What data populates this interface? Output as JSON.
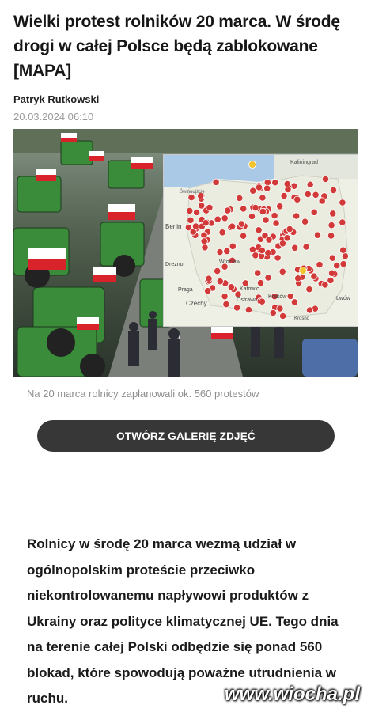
{
  "article": {
    "title": "Wielki protest rolników 20 marca. W środę drogi w całej Polsce będą zablokowane [MAPA]",
    "author": "Patryk Rutkowski",
    "date": "20.03.2024 06:10",
    "caption": "Na 20 marca rolnicy zaplanowali ok. 560 protestów",
    "gallery_button": "OTWÓRZ GALERIĘ ZDJĘĆ",
    "lead": "Rolnicy w środę 20 marca wezmą udział w ogólnopolskim proteście przeciwko niekontrolowanemu napływowi produktów z Ukrainy oraz polityce klimatycznej UE. Tego dnia na terenie całej Polski odbędzie się ponad 560 blokad, które spowodują poważne utrudnienia w ruchu."
  },
  "map": {
    "labels": {
      "kaliningrad": "Kaliningrad",
      "berlin": "Berlin",
      "drezno": "Drezno",
      "praga": "Praga",
      "czechy": "Czechy",
      "katowice": "Katowic",
      "ostrawa": "Ostrawa",
      "krakow": "Kraków",
      "swinoujscie": "Świnoujście",
      "wroclaw": "Wrocław",
      "lwow": "Lwów",
      "krosno": "Krosno"
    },
    "colors": {
      "water": "#aac9e6",
      "land": "#eef0e6",
      "poland": "#e9ecdf",
      "marker": "#d23a3a",
      "highlight": "#f4c430"
    }
  },
  "colors": {
    "flag_red": "#d8232a",
    "tractor_green": "#3a8b3a",
    "button_bg": "#373737"
  },
  "watermark": "www.wiocha.pl"
}
